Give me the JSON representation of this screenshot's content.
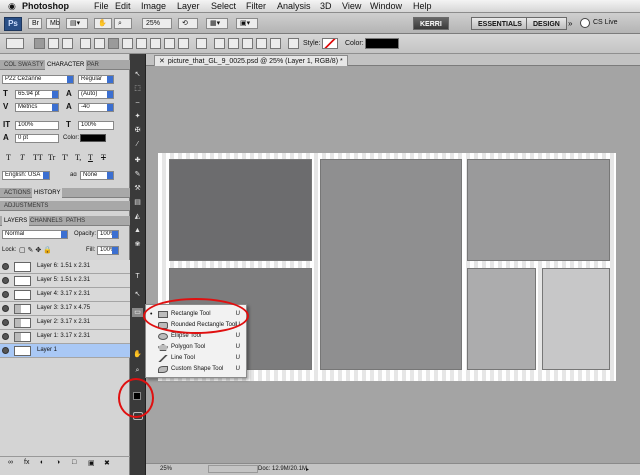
{
  "menubar": {
    "apple": "",
    "app_name": "Photoshop",
    "items": [
      "File",
      "Edit",
      "Image",
      "Layer",
      "Select",
      "Filter",
      "Analysis",
      "3D",
      "View",
      "Window",
      "Help"
    ]
  },
  "appbar": {
    "logo": "Ps",
    "zoom": "25%",
    "workspaces": [
      "KERRI",
      "ESSENTIALS",
      "DESIGN"
    ],
    "more": "»",
    "cs_live": "CS Live"
  },
  "options": {
    "style_label": "Style:",
    "color_label": "Color:"
  },
  "char_panel": {
    "tabs": [
      "COL",
      "SWA",
      "STY",
      "CHARACTER",
      "PAR"
    ],
    "font_family": "P22 Cezanne",
    "font_style": "Regular",
    "font_size": "65.94 pt",
    "leading": "(Auto)",
    "kerning": "Metrics",
    "tracking": "-40",
    "vscale": "100%",
    "hscale": "100%",
    "baseline": "0 pt",
    "color_label": "Color:",
    "language": "English: USA",
    "aa_label": "aɑ",
    "antialias": "None",
    "type_styles": [
      "T",
      "T",
      "TT",
      "Tr",
      "T'",
      "T,",
      "T",
      "T"
    ]
  },
  "history_tabs": [
    "ACTIONS",
    "HISTORY"
  ],
  "adjustments_tab": "ADJUSTMENTS",
  "layers_panel": {
    "tabs": [
      "LAYERS",
      "CHANNELS",
      "PATHS"
    ],
    "blend_mode": "Normal",
    "opacity_label": "Opacity:",
    "opacity": "100%",
    "lock_label": "Lock:",
    "fill_label": "Fill:",
    "fill": "100%",
    "layers": [
      {
        "name": "Layer 6: 1.51 x 2.31"
      },
      {
        "name": "Layer 5: 1.51 x 2.31"
      },
      {
        "name": "Layer 4: 3.17 x 2.31"
      },
      {
        "name": "Layer 3: 3.17 x 4.75"
      },
      {
        "name": "Layer 2: 3.17 x 2.31"
      },
      {
        "name": "Layer 1: 3.17 x 2.31"
      },
      {
        "name": "Layer 1"
      }
    ],
    "footer_icons": [
      "link-icon",
      "fx-icon",
      "mask-icon",
      "adjustment-icon",
      "group-icon",
      "new-layer-icon",
      "trash-icon"
    ],
    "footer_labels": [
      "∞",
      "fx",
      "◐",
      "◑",
      "□",
      "▣",
      "✖"
    ]
  },
  "document": {
    "tab_title": "picture_that_GL_9_0025.psd @ 25% (Layer 1, RGB/8) *"
  },
  "status": {
    "zoom": "25%",
    "doc": "Doc: 12.9M/20.1M"
  },
  "flyout": {
    "items": [
      {
        "label": "Rectangle Tool",
        "key": "U",
        "selected": true
      },
      {
        "label": "Rounded Rectangle Tool",
        "key": "U"
      },
      {
        "label": "Ellipse Tool",
        "key": "U"
      },
      {
        "label": "Polygon Tool",
        "key": "U"
      },
      {
        "label": "Line Tool",
        "key": "U"
      },
      {
        "label": "Custom Shape Tool",
        "key": "U"
      }
    ]
  },
  "tools": [
    "↖",
    "⬚",
    "⌢",
    "✦",
    "✠",
    "⁄",
    "✚",
    "✎",
    "⚒",
    "▤",
    "◭",
    "▲",
    "❀",
    "T",
    "↖",
    "▭",
    "✋",
    "⌕"
  ],
  "colors": {
    "accent": "#3b6fd1",
    "annotation_red": "#e01010",
    "panel_bg": "#d4d4d4",
    "layer_selected": "#a9c8f5"
  }
}
